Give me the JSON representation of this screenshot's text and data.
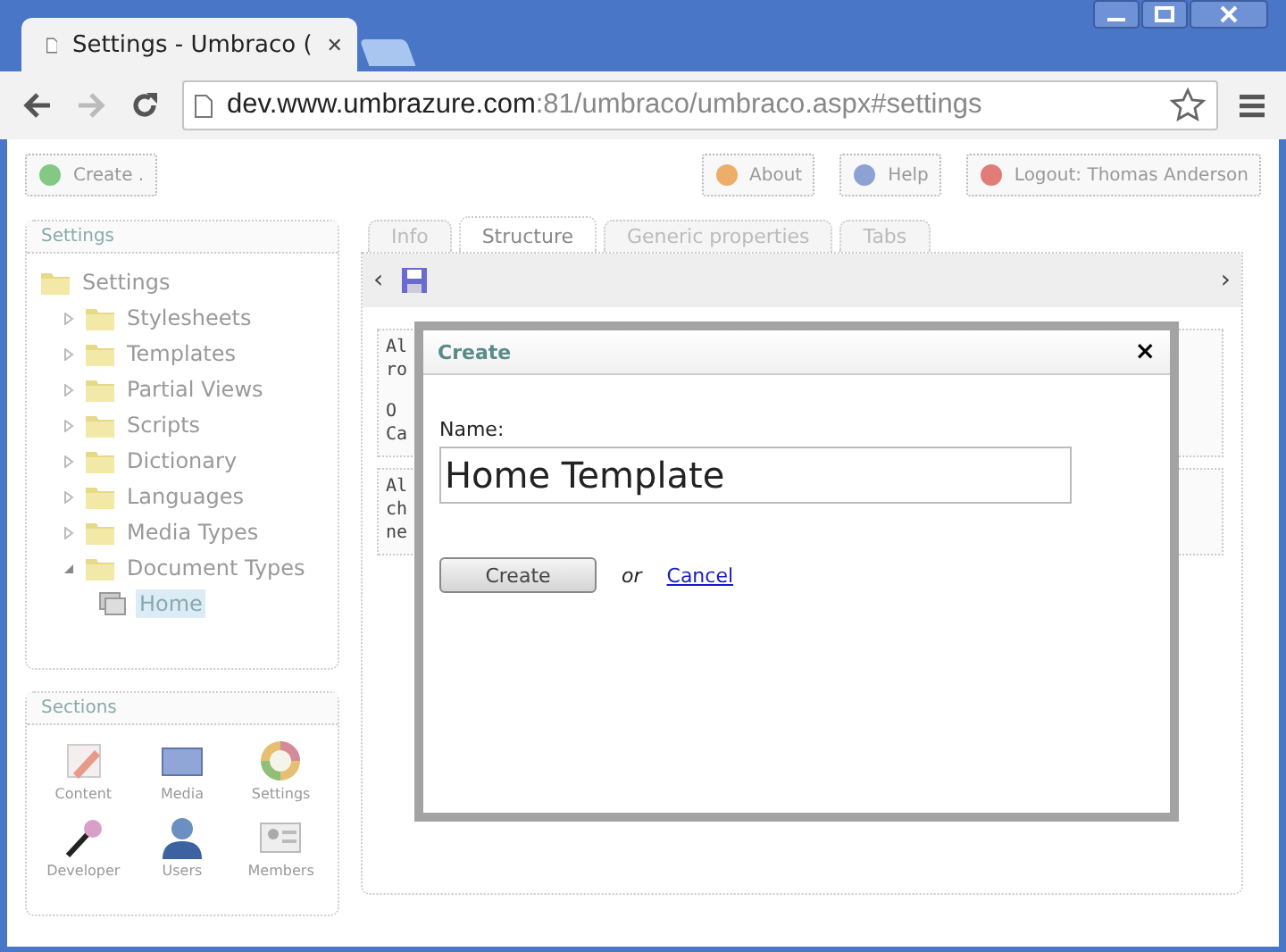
{
  "browser": {
    "tab_title": "Settings - Umbraco (",
    "tab_close": "✕",
    "url_host": "dev.www.umbrazure.com",
    "url_path": ":81/umbraco/umbraco.aspx#settings"
  },
  "top_buttons": [
    {
      "label": "Create .",
      "kind": "create"
    },
    {
      "label": "About",
      "kind": "about"
    },
    {
      "label": "Help",
      "kind": "help"
    },
    {
      "label": "Logout: Thomas Anderson",
      "kind": "logout"
    }
  ],
  "tree_panel": {
    "title": "Settings",
    "items": [
      {
        "label": "Settings",
        "kind": "folder",
        "selected": false,
        "children": [
          {
            "label": "Stylesheets",
            "kind": "folder",
            "expanded": false,
            "selected": false
          },
          {
            "label": "Templates",
            "kind": "folder",
            "expanded": false,
            "selected": false
          },
          {
            "label": "Partial Views",
            "kind": "folder",
            "expanded": false,
            "selected": false
          },
          {
            "label": "Scripts",
            "kind": "folder",
            "expanded": false,
            "selected": false
          },
          {
            "label": "Dictionary",
            "kind": "folder",
            "expanded": false,
            "selected": false
          },
          {
            "label": "Languages",
            "kind": "folder",
            "expanded": false,
            "selected": false
          },
          {
            "label": "Media Types",
            "kind": "folder",
            "expanded": false,
            "selected": false
          },
          {
            "label": "Document Types",
            "kind": "folder",
            "expanded": true,
            "selected": false,
            "children": [
              {
                "label": "Home",
                "kind": "doctype",
                "selected": true
              }
            ]
          }
        ]
      }
    ]
  },
  "sections_panel": {
    "title": "Sections",
    "items": [
      {
        "label": "Content",
        "kind": "content"
      },
      {
        "label": "Media",
        "kind": "media"
      },
      {
        "label": "Settings",
        "kind": "settings"
      },
      {
        "label": "Developer",
        "kind": "developer"
      },
      {
        "label": "Users",
        "kind": "users"
      },
      {
        "label": "Members",
        "kind": "members"
      }
    ]
  },
  "tabs": [
    {
      "label": "Info",
      "selected": false
    },
    {
      "label": "Structure",
      "selected": true
    },
    {
      "label": "Generic properties",
      "selected": false
    },
    {
      "label": "Tabs",
      "selected": false
    }
  ],
  "content_toolbar": {
    "left_arrow": "‹",
    "right_arrow": "›"
  },
  "content_blocks": [
    {
      "lines": [
        "Al",
        "ro",
        "O",
        "Ca"
      ]
    },
    {
      "lines": [
        "Al",
        "ch",
        "ne"
      ]
    }
  ],
  "dialog": {
    "title": "Create",
    "close": "×",
    "name_label": "Name:",
    "name_value": "Home Template",
    "create_button": "Create",
    "or_text": "or",
    "cancel_link": "Cancel"
  }
}
